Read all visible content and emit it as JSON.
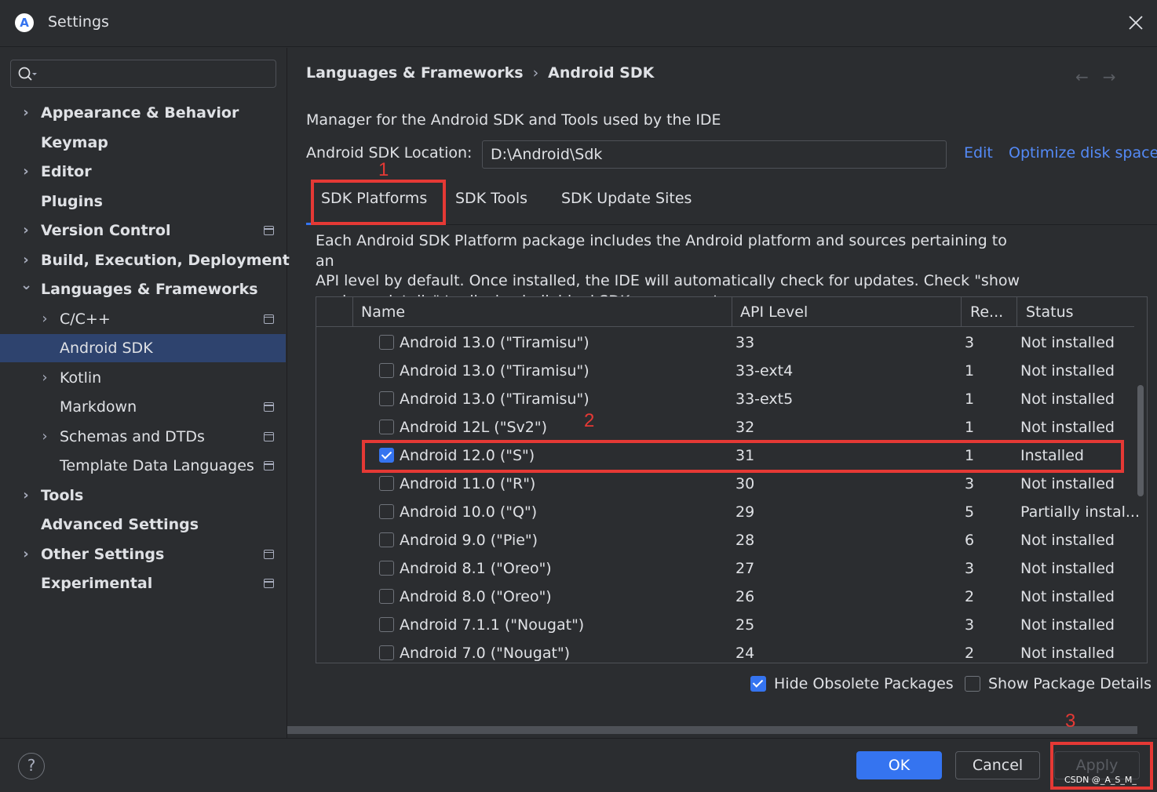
{
  "window": {
    "title": "Settings",
    "logo_glyph": "A"
  },
  "search": {
    "placeholder": ""
  },
  "sidebar": {
    "items": [
      {
        "label": "Appearance & Behavior",
        "bold": true,
        "expandable": true,
        "expanded": false,
        "indent": 0,
        "project_icon": false
      },
      {
        "label": "Keymap",
        "bold": true,
        "expandable": false,
        "indent": 0,
        "project_icon": false
      },
      {
        "label": "Editor",
        "bold": true,
        "expandable": true,
        "expanded": false,
        "indent": 0,
        "project_icon": false
      },
      {
        "label": "Plugins",
        "bold": true,
        "expandable": false,
        "indent": 0,
        "project_icon": false
      },
      {
        "label": "Version Control",
        "bold": true,
        "expandable": true,
        "expanded": false,
        "indent": 0,
        "project_icon": true
      },
      {
        "label": "Build, Execution, Deployment",
        "bold": true,
        "expandable": true,
        "expanded": false,
        "indent": 0,
        "project_icon": false
      },
      {
        "label": "Languages & Frameworks",
        "bold": true,
        "expandable": true,
        "expanded": true,
        "indent": 0,
        "project_icon": false
      },
      {
        "label": "C/C++",
        "bold": false,
        "expandable": true,
        "expanded": false,
        "indent": 1,
        "project_icon": true
      },
      {
        "label": "Android SDK",
        "bold": false,
        "expandable": false,
        "indent": 1,
        "project_icon": false,
        "selected": true
      },
      {
        "label": "Kotlin",
        "bold": false,
        "expandable": true,
        "expanded": false,
        "indent": 1,
        "project_icon": false
      },
      {
        "label": "Markdown",
        "bold": false,
        "expandable": false,
        "indent": 1,
        "project_icon": true
      },
      {
        "label": "Schemas and DTDs",
        "bold": false,
        "expandable": true,
        "expanded": false,
        "indent": 1,
        "project_icon": true
      },
      {
        "label": "Template Data Languages",
        "bold": false,
        "expandable": false,
        "indent": 1,
        "project_icon": true
      },
      {
        "label": "Tools",
        "bold": true,
        "expandable": true,
        "expanded": false,
        "indent": 0,
        "project_icon": false
      },
      {
        "label": "Advanced Settings",
        "bold": true,
        "expandable": false,
        "indent": 0,
        "project_icon": false
      },
      {
        "label": "Other Settings",
        "bold": true,
        "expandable": true,
        "expanded": false,
        "indent": 0,
        "project_icon": true
      },
      {
        "label": "Experimental",
        "bold": true,
        "expandable": false,
        "indent": 0,
        "project_icon": true
      }
    ]
  },
  "breadcrumb": {
    "parent": "Languages & Frameworks",
    "separator": "›",
    "current": "Android SDK"
  },
  "nav_arrows": {
    "back": "←",
    "forward": "→"
  },
  "main": {
    "description": "Manager for the Android SDK and Tools used by the IDE",
    "sdk_location_label": "Android SDK Location:",
    "sdk_location_value": "D:\\Android\\Sdk",
    "edit_link": "Edit",
    "optimize_link": "Optimize disk space",
    "tabs": [
      {
        "label": "SDK Platforms",
        "active": true
      },
      {
        "label": "SDK Tools",
        "active": false
      },
      {
        "label": "SDK Update Sites",
        "active": false
      }
    ],
    "platform_description_lines": [
      "Each Android SDK Platform package includes the Android platform and sources pertaining to an",
      "API level by default. Once installed, the IDE will automatically check for updates. Check \"show",
      "package details\" to display individual SDK components."
    ]
  },
  "table": {
    "columns": [
      "Name",
      "API Level",
      "Re...",
      "Status"
    ],
    "rows": [
      {
        "name": "Android 13.0 (\"Tiramisu\")",
        "api": "33",
        "rev": "3",
        "status": "Not installed",
        "checked": false
      },
      {
        "name": "Android 13.0 (\"Tiramisu\")",
        "api": "33-ext4",
        "rev": "1",
        "status": "Not installed",
        "checked": false
      },
      {
        "name": "Android 13.0 (\"Tiramisu\")",
        "api": "33-ext5",
        "rev": "1",
        "status": "Not installed",
        "checked": false
      },
      {
        "name": "Android 12L (\"Sv2\")",
        "api": "32",
        "rev": "1",
        "status": "Not installed",
        "checked": false
      },
      {
        "name": "Android 12.0 (\"S\")",
        "api": "31",
        "rev": "1",
        "status": "Installed",
        "checked": true
      },
      {
        "name": "Android 11.0 (\"R\")",
        "api": "30",
        "rev": "3",
        "status": "Not installed",
        "checked": false
      },
      {
        "name": "Android 10.0 (\"Q\")",
        "api": "29",
        "rev": "5",
        "status": "Partially instal...",
        "checked": false
      },
      {
        "name": "Android 9.0 (\"Pie\")",
        "api": "28",
        "rev": "6",
        "status": "Not installed",
        "checked": false
      },
      {
        "name": "Android 8.1 (\"Oreo\")",
        "api": "27",
        "rev": "3",
        "status": "Not installed",
        "checked": false
      },
      {
        "name": "Android 8.0 (\"Oreo\")",
        "api": "26",
        "rev": "2",
        "status": "Not installed",
        "checked": false
      },
      {
        "name": "Android 7.1.1 (\"Nougat\")",
        "api": "25",
        "rev": "3",
        "status": "Not installed",
        "checked": false
      },
      {
        "name": "Android 7.0 (\"Nougat\")",
        "api": "24",
        "rev": "2",
        "status": "Not installed",
        "checked": false
      }
    ]
  },
  "options": {
    "hide_obsolete": {
      "label": "Hide Obsolete Packages",
      "checked": true
    },
    "show_details": {
      "label": "Show Package Details",
      "checked": false
    }
  },
  "footer": {
    "help": "?",
    "ok": "OK",
    "cancel": "Cancel",
    "apply": "Apply",
    "watermark": "CSDN @_A_S_M_"
  },
  "annotations": {
    "one": "1",
    "two": "2",
    "three": "3",
    "color": "#e53935"
  },
  "colors": {
    "accent": "#3574f0",
    "link": "#548af7",
    "selected_row": "#2e436e",
    "background": "#2b2d30"
  }
}
